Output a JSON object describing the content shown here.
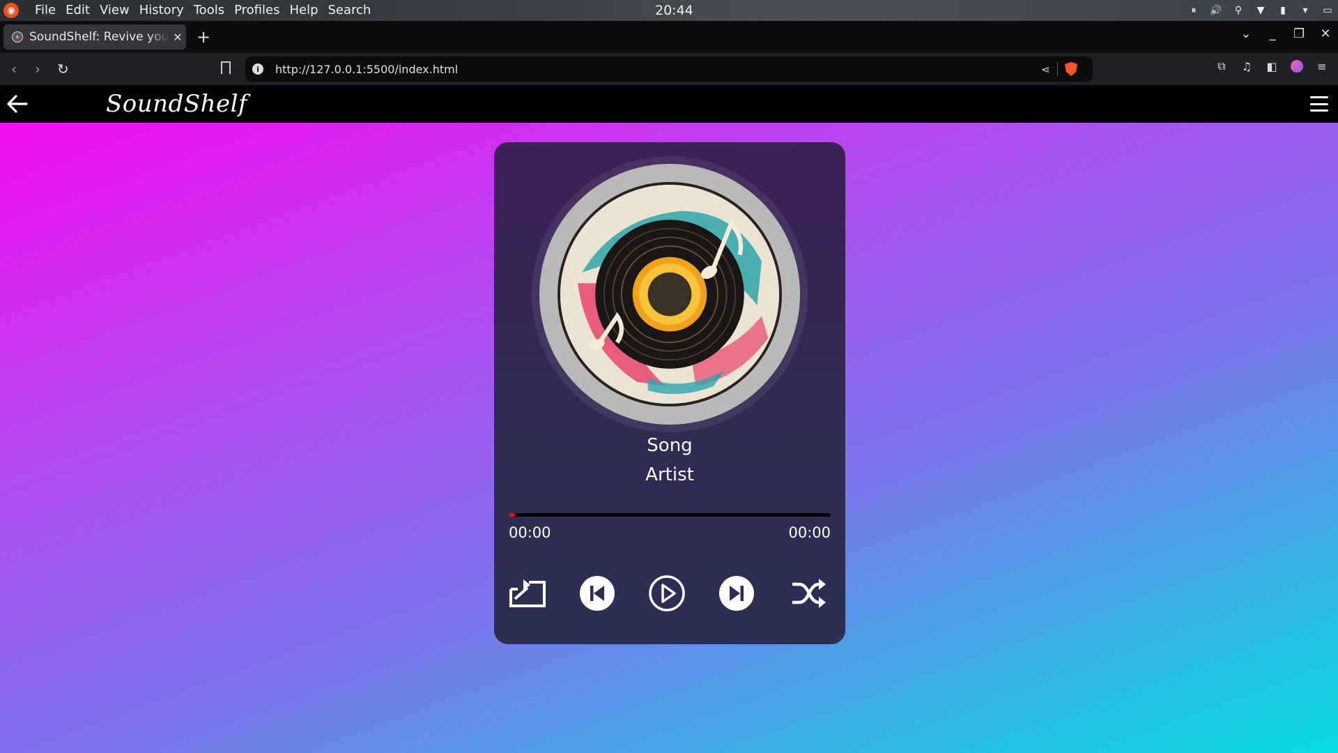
{
  "os": {
    "menu": [
      "File",
      "Edit",
      "View",
      "History",
      "Tools",
      "Profiles",
      "Help",
      "Search"
    ],
    "clock": "20:44"
  },
  "browser": {
    "tab_title": "SoundShelf: Revive your",
    "url": "http://127.0.0.1:5500/index.html"
  },
  "site": {
    "logo": "SoundShelf"
  },
  "player": {
    "song": "Song",
    "artist": "Artist",
    "current_time": "00:00",
    "duration": "00:00",
    "progress": 0.02,
    "accent_color": "#e0141c",
    "controls": [
      "repeat-icon",
      "previous-icon",
      "play-icon",
      "next-icon",
      "shuffle-icon"
    ]
  }
}
